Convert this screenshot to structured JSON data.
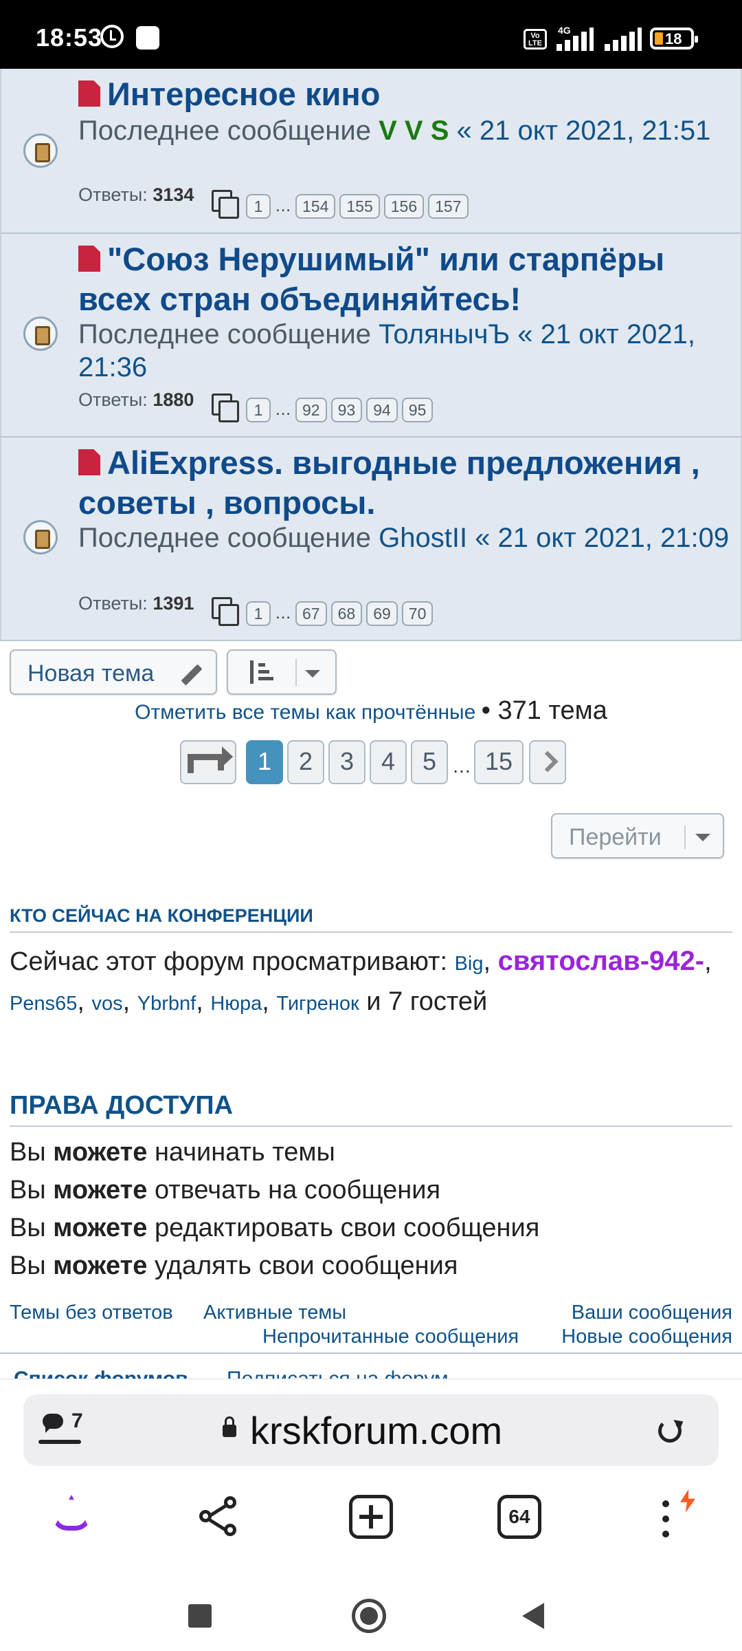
{
  "status_bar": {
    "time": "18:53",
    "network": "4G",
    "volte": "Vo LTE",
    "battery": "18"
  },
  "topics": [
    {
      "title": "Интересное кино",
      "last_post_label": "Последнее сообщение",
      "author": "V V S",
      "date": "« 21 окт 2021, 21:51",
      "replies_label": "Ответы:",
      "replies": "3134",
      "pages": [
        "1",
        "…",
        "154",
        "155",
        "156",
        "157"
      ]
    },
    {
      "title": "\"Союз Нерушимый\" или старпёры всех стран объединяйтесь!",
      "last_post_label": "Последнее сообщение",
      "author": "ТолянычЪ",
      "date": "« 21 окт 2021, 21:36",
      "replies_label": "Ответы:",
      "replies": "1880",
      "pages": [
        "1",
        "…",
        "92",
        "93",
        "94",
        "95"
      ]
    },
    {
      "title": "AliExpress. выгодные предложения , советы , вопросы.",
      "last_post_label": "Последнее сообщение",
      "author": "GhostII",
      "date": "« 21 окт 2021, 21:09",
      "replies_label": "Ответы:",
      "replies": "1391",
      "pages": [
        "1",
        "…",
        "67",
        "68",
        "69",
        "70"
      ]
    }
  ],
  "actions": {
    "new_topic": "Новая тема",
    "mark_all_read": "Отметить все темы как прочтённые",
    "topic_count": "• 371 тема",
    "go_label": "Перейти"
  },
  "pagination": {
    "pages": [
      "1",
      "2",
      "3",
      "4",
      "5"
    ],
    "dots": "…",
    "last": "15",
    "current": "1"
  },
  "online": {
    "heading": "КТО СЕЙЧАС НА КОНФЕРЕНЦИИ",
    "intro": "Сейчас этот форум просматривают:",
    "users": [
      "Big",
      "святослав-942-",
      "Pens65",
      "vos",
      "Ybrbnf",
      "Нюра",
      "Тигренок"
    ],
    "guests_prefix": "и 7",
    "guests_suffix": "гостей"
  },
  "permissions": {
    "heading": "ПРАВА ДОСТУПА",
    "prefix": "Вы",
    "can": "можете",
    "items": [
      "начинать темы",
      "отвечать на сообщения",
      "редактировать свои сообщения",
      "удалять свои сообщения"
    ]
  },
  "footer_links": {
    "unanswered": "Темы без ответов",
    "active": "Активные темы",
    "your_posts": "Ваши сообщения",
    "unread": "Непрочитанные сообщения",
    "new_posts": "Новые сообщения",
    "forum_list": "Список форумов",
    "subscribe": "Подписаться на форум"
  },
  "browser": {
    "tab_badge": "7",
    "url": "krskforum.com",
    "tabs_count": "64"
  },
  "colors": {
    "topic_bg": "#e1e8ef",
    "link": "#105289",
    "title": "#0f4a8a",
    "pagination_active": "#4692bf",
    "special_user": "#9a24d8",
    "green_user": "#1b7a14"
  }
}
